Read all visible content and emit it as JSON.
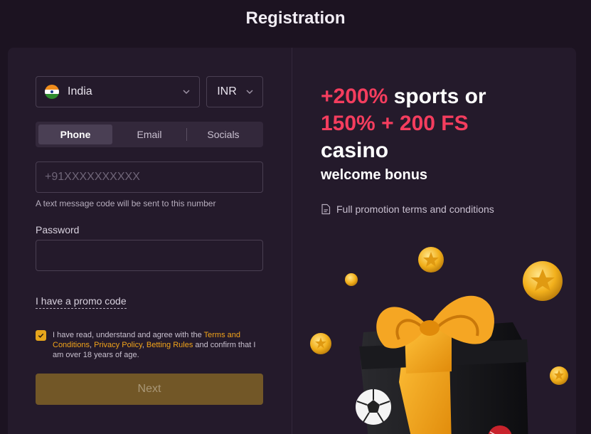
{
  "page_title": "Registration",
  "form": {
    "country": {
      "value": "India",
      "flag_icon": "india-flag-icon"
    },
    "currency": {
      "value": "INR"
    },
    "tabs": [
      {
        "label": "Phone",
        "active": true
      },
      {
        "label": "Email",
        "active": false
      },
      {
        "label": "Socials",
        "active": false
      }
    ],
    "phone": {
      "placeholder": "+91XXXXXXXXXX",
      "hint": "A text message code will be sent to this number"
    },
    "password": {
      "label": "Password",
      "value": ""
    },
    "promo_link": "I have a promo code",
    "agreement": {
      "checked": true,
      "text_1": "I have read, understand and agree with the ",
      "link_terms": "Terms and Conditions",
      "sep_1": ", ",
      "link_privacy": "Privacy Policy",
      "sep_2": ", ",
      "link_betting": "Betting Rules",
      "text_2": " and confirm that I am over 18 years of age."
    },
    "next_label": "Next"
  },
  "bonus": {
    "line1_red": "+200%",
    "line1_white": " sports or",
    "line2_red": "150% + 200 FS",
    "line3_white": "casino",
    "subtitle": "welcome bonus",
    "terms_link": "Full promotion terms and conditions"
  },
  "colors": {
    "background": "#1c1321",
    "card": "#241a2b",
    "accent": "#f2a41a",
    "promo_red": "#f43d5e",
    "next_button": "#725727"
  }
}
